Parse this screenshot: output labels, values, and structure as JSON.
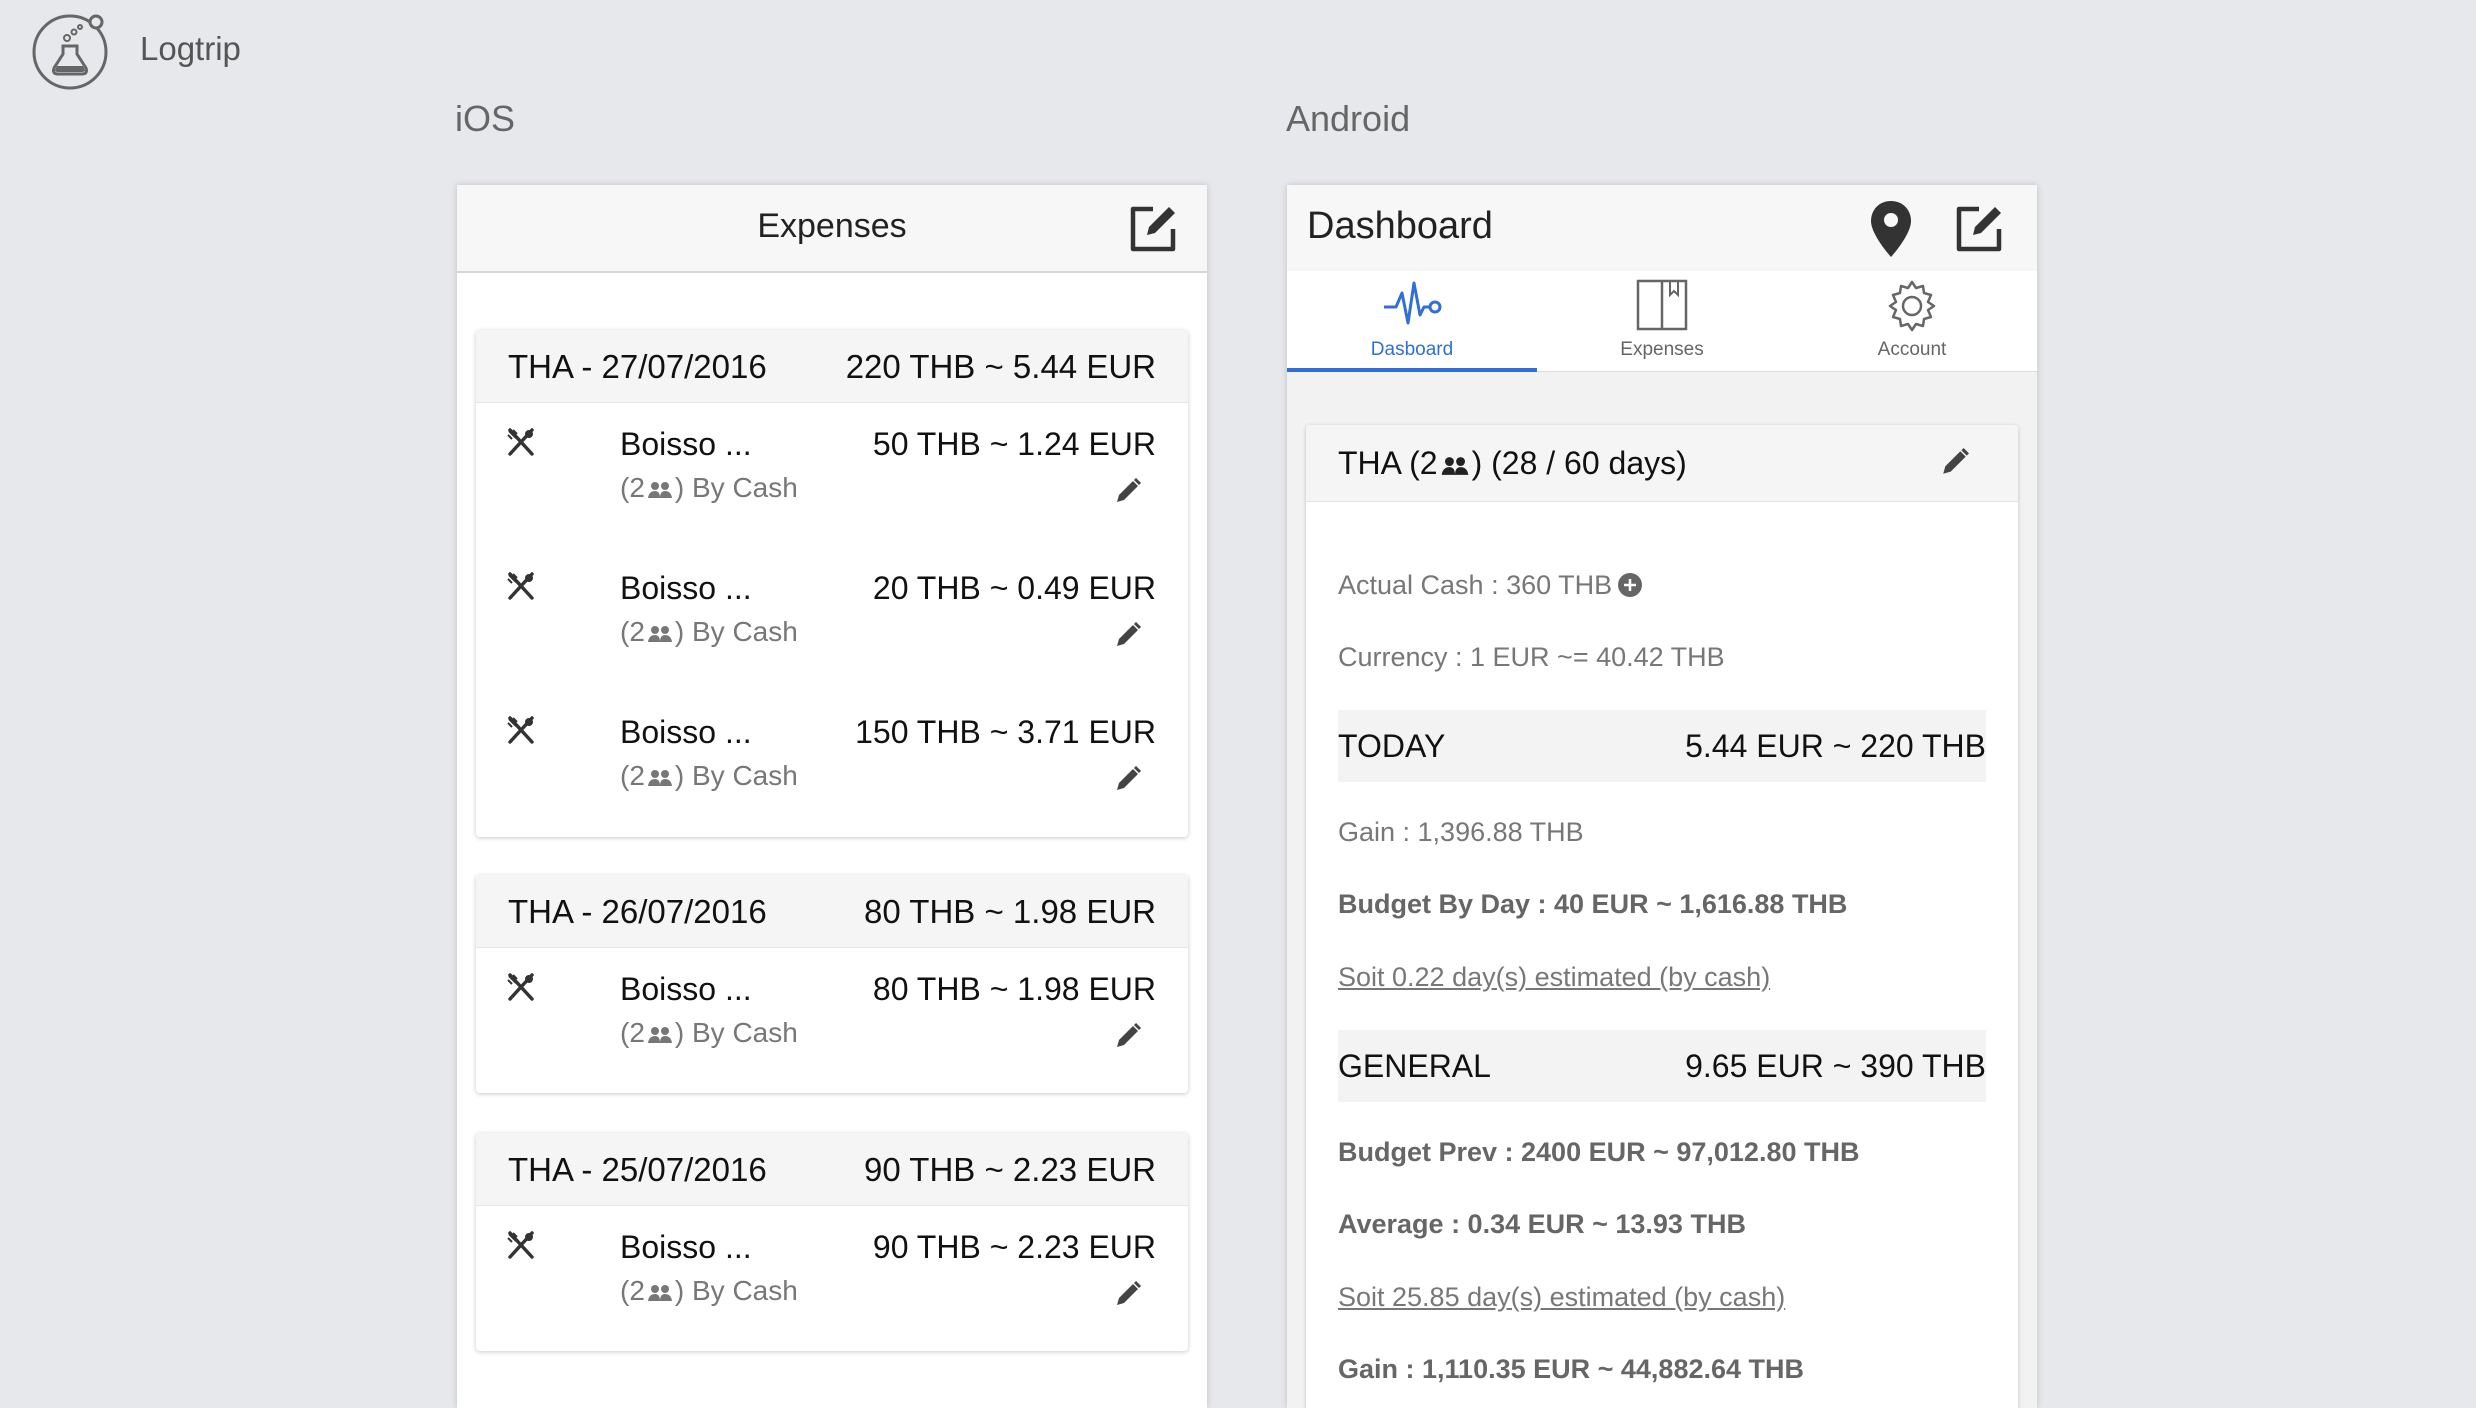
{
  "brand": {
    "name": "Logtrip"
  },
  "sections": {
    "ios": "iOS",
    "android": "Android"
  },
  "ios": {
    "title": "Expenses",
    "groups": [
      {
        "date": "THA - 27/07/2016",
        "total": "220 THB ~ 5.44 EUR",
        "items": [
          {
            "name": "Boisso ...",
            "amount": "50 THB ~ 1.24 EUR",
            "people": "(2",
            "payment": ") By Cash"
          },
          {
            "name": "Boisso ...",
            "amount": "20 THB ~ 0.49 EUR",
            "people": "(2",
            "payment": ") By Cash"
          },
          {
            "name": "Boisso ...",
            "amount": "150 THB ~ 3.71 EUR",
            "people": "(2",
            "payment": ") By Cash"
          }
        ]
      },
      {
        "date": "THA - 26/07/2016",
        "total": "80 THB ~ 1.98 EUR",
        "items": [
          {
            "name": "Boisso ...",
            "amount": "80 THB ~ 1.98 EUR",
            "people": "(2",
            "payment": ") By Cash"
          }
        ]
      },
      {
        "date": "THA - 25/07/2016",
        "total": "90 THB ~ 2.23 EUR",
        "items": [
          {
            "name": "Boisso ...",
            "amount": "90 THB ~ 2.23 EUR",
            "people": "(2",
            "payment": ") By Cash"
          }
        ]
      }
    ]
  },
  "android": {
    "title": "Dashboard",
    "tabs": [
      {
        "label": "Dasboard",
        "active": true
      },
      {
        "label": "Expenses",
        "active": false
      },
      {
        "label": "Account",
        "active": false
      }
    ],
    "accent": "#2f6fd6",
    "trip": {
      "prefix": "THA (2",
      "suffix": ") (28 / 60 days)"
    },
    "actual_cash": "Actual Cash : 360 THB",
    "currency": "Currency : 1 EUR ~= 40.42 THB",
    "today": {
      "label": "TODAY",
      "value": "5.44 EUR ~ 220 THB"
    },
    "today_gain": "Gain : 1,396.88 THB",
    "budget_by_day": "Budget By Day : 40 EUR ~ 1,616.88 THB",
    "today_estimate": "Soit 0.22 day(s) estimated (by cash)",
    "general": {
      "label": "GENERAL",
      "value": "9.65 EUR ~ 390 THB"
    },
    "budget_prev": "Budget Prev : 2400 EUR ~ 97,012.80 THB",
    "average": "Average : 0.34 EUR ~ 13.93 THB",
    "general_estimate": "Soit 25.85 day(s) estimated (by cash)",
    "general_gain": "Gain : 1,110.35 EUR ~ 44,882.64 THB"
  }
}
